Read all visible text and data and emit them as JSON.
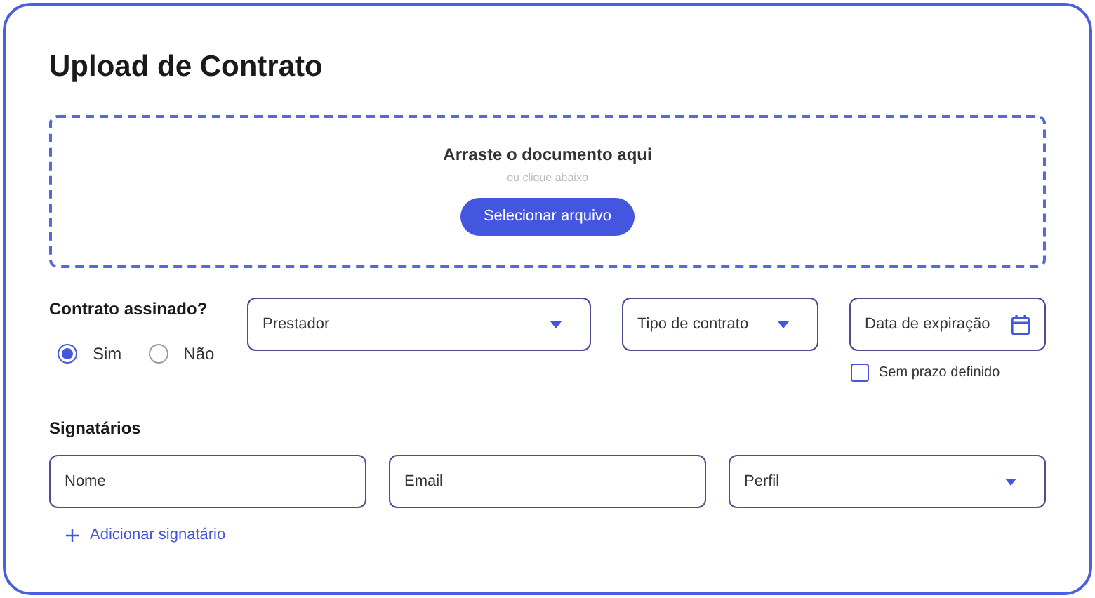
{
  "title": "Upload de Contrato",
  "dropzone": {
    "heading": "Arraste o documento aqui",
    "hint": "ou clique abaixo",
    "button": "Selecionar arquivo"
  },
  "signed": {
    "label": "Contrato assinado?",
    "options": [
      {
        "label": "Sim",
        "selected": true
      },
      {
        "label": "Não",
        "selected": false
      }
    ]
  },
  "contract_fields": [
    {
      "kind": "select",
      "placeholder": "Prestador"
    },
    {
      "kind": "select",
      "placeholder": "Tipo de contrato"
    },
    {
      "kind": "date",
      "placeholder": "Data de expiração"
    }
  ],
  "no_deadline": {
    "label": "Sem prazo definido",
    "checked": false
  },
  "signatories": {
    "heading": "Signatários",
    "fields": [
      {
        "kind": "text",
        "placeholder": "Nome"
      },
      {
        "kind": "text",
        "placeholder": "Email"
      },
      {
        "kind": "select",
        "placeholder": "Perfil"
      }
    ],
    "add_link": "Adicionar signatário"
  }
}
